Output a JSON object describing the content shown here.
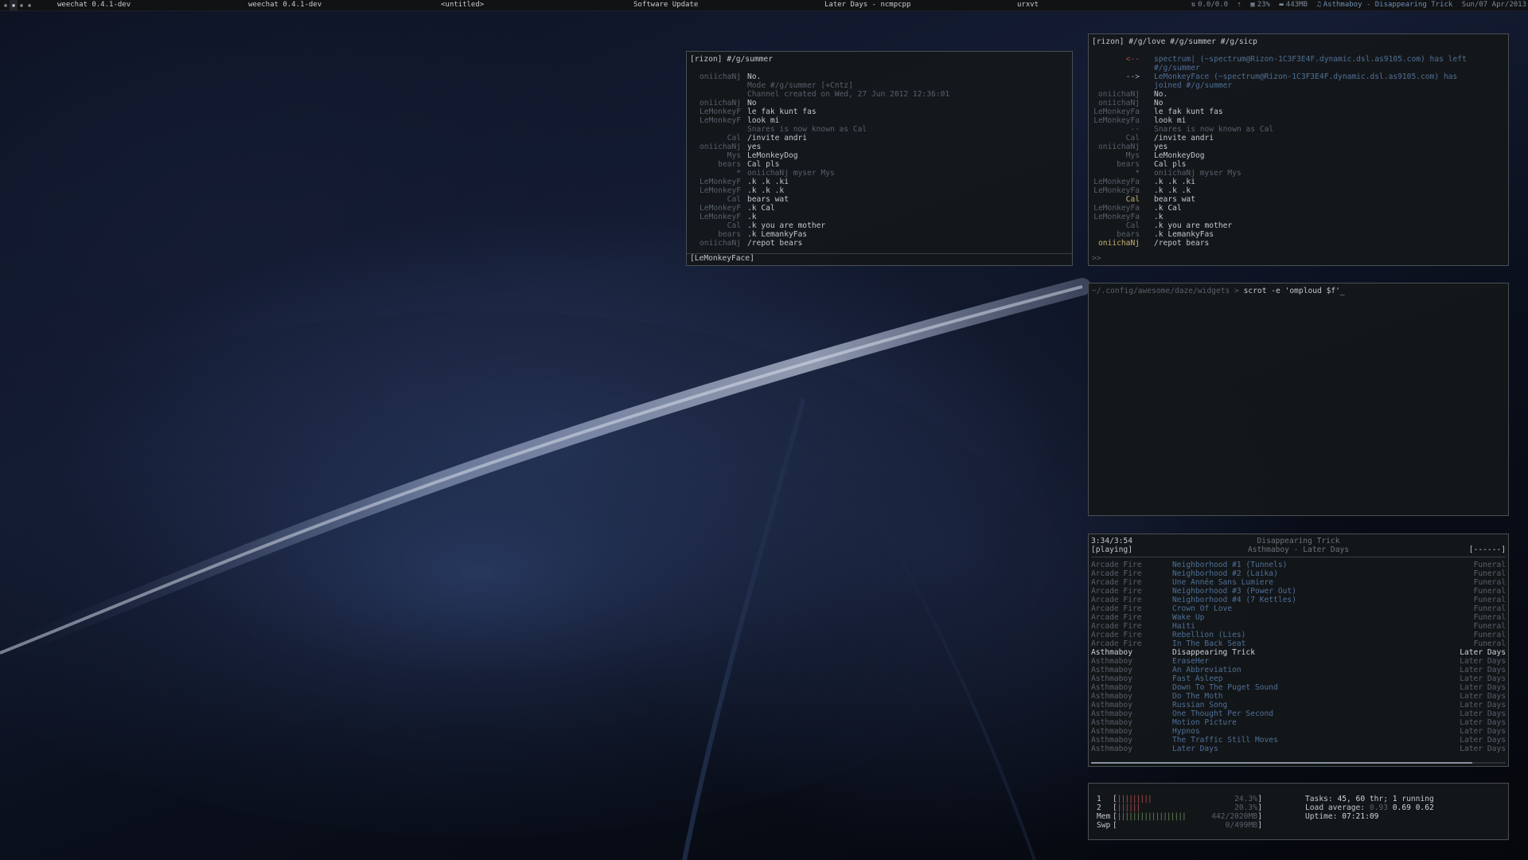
{
  "topbar": {
    "tasks": [
      {
        "label": "weechat 0.4.1-dev"
      },
      {
        "label": "weechat 0.4.1-dev"
      },
      {
        "label": "<untitled>"
      },
      {
        "label": "Software Update"
      },
      {
        "label": "Later Days - ncmpcpp"
      },
      {
        "label": "urxvt"
      }
    ],
    "widgets": {
      "net": "0.0/0.0",
      "cpu": "23%",
      "mem": "443MB",
      "nowplaying": "Asthmaboy - Disappearing Trick",
      "date": "Sun/07 Apr/2013"
    }
  },
  "chat1": {
    "title": "[rizon] #/g/summer",
    "lines": [
      {
        "nick": "oniichaNj",
        "text": "No.",
        "style": "norm"
      },
      {
        "nick": "",
        "text": "Mode #/g/summer [+Cntz]",
        "style": "dim"
      },
      {
        "nick": "",
        "text": "Channel created on Wed, 27 Jun 2012 12:36:01",
        "style": "dim"
      },
      {
        "nick": "oniichaNj",
        "text": "No",
        "style": "norm"
      },
      {
        "nick": "LeMonkeyF",
        "text": "le fak kunt fas",
        "style": "norm"
      },
      {
        "nick": "LeMonkeyF",
        "text": "look mi",
        "style": "norm"
      },
      {
        "nick": "",
        "text": "Snares is now known as Cal",
        "style": "dim"
      },
      {
        "nick": "Cal",
        "text": "/invite andri",
        "style": "norm"
      },
      {
        "nick": "oniichaNj",
        "text": "yes",
        "style": "norm"
      },
      {
        "nick": "Mys",
        "text": "LeMonkeyDog",
        "style": "norm"
      },
      {
        "nick": "bears",
        "text": "Cal pls",
        "style": "norm"
      },
      {
        "nick": "*",
        "text": "oniichaNj myser Mys",
        "style": "dim"
      },
      {
        "nick": "LeMonkeyF",
        "text": ".k .k .ki",
        "style": "norm"
      },
      {
        "nick": "LeMonkeyF",
        "text": ".k .k .k",
        "style": "norm"
      },
      {
        "nick": "Cal",
        "text": "bears wat",
        "style": "norm"
      },
      {
        "nick": "LeMonkeyF",
        "text": ".k Cal",
        "style": "norm"
      },
      {
        "nick": "LeMonkeyF",
        "text": ".k",
        "style": "norm"
      },
      {
        "nick": "Cal",
        "text": ".k you are mother",
        "style": "norm"
      },
      {
        "nick": "bears",
        "text": ".k LemankyFas",
        "style": "norm"
      },
      {
        "nick": "oniichaNj",
        "text": "/repot bears",
        "style": "norm"
      }
    ],
    "input": "[LeMonkeyFace]"
  },
  "chat2": {
    "title": "[rizon] #/g/love #/g/summer #/g/sicp",
    "lines": [
      {
        "nick": "<--",
        "text": "spectrum| (~spectrum@Rizon-1C3F3E4F.dynamic.dsl.as9105.com) has left",
        "style": "out"
      },
      {
        "nick": "",
        "text": "#/g/summer",
        "style": "cont"
      },
      {
        "nick": "-->",
        "text": "LeMonkeyFace (~spectrum@Rizon-1C3F3E4F.dynamic.dsl.as9105.com) has",
        "style": "in"
      },
      {
        "nick": "",
        "text": "joined #/g/summer",
        "style": "cont"
      },
      {
        "nick": "oniichaNj",
        "text": "No.",
        "style": "norm"
      },
      {
        "nick": "oniichaNj",
        "text": "No",
        "style": "norm"
      },
      {
        "nick": "LeMonkeyFa",
        "text": "le fak kunt fas",
        "style": "norm"
      },
      {
        "nick": "LeMonkeyFa",
        "text": "look mi",
        "style": "norm"
      },
      {
        "nick": "--",
        "text": "Snares is now known as Cal",
        "style": "dim"
      },
      {
        "nick": "Cal",
        "text": "/invite andri",
        "style": "norm"
      },
      {
        "nick": "oniichaNj",
        "text": "yes",
        "style": "norm"
      },
      {
        "nick": "Mys",
        "text": "LeMonkeyDog",
        "style": "norm"
      },
      {
        "nick": "bears",
        "text": "Cal pls",
        "style": "norm"
      },
      {
        "nick": "*",
        "text": "oniichaNj myser Mys",
        "style": "dim"
      },
      {
        "nick": "LeMonkeyFa",
        "text": ".k .k .ki",
        "style": "norm"
      },
      {
        "nick": "LeMonkeyFa",
        "text": ".k .k .k",
        "style": "norm"
      },
      {
        "nick": "Cal",
        "text": "bears wat",
        "style": "self"
      },
      {
        "nick": "LeMonkeyFa",
        "text": ".k Cal",
        "style": "norm"
      },
      {
        "nick": "LeMonkeyFa",
        "text": ".k",
        "style": "norm"
      },
      {
        "nick": "Cal",
        "text": ".k you are mother",
        "style": "norm"
      },
      {
        "nick": "bears",
        "text": ".k LemankyFas",
        "style": "norm"
      },
      {
        "nick": "oniichaNj",
        "text": "/repot bears",
        "style": "selfnick"
      }
    ],
    "prompt": ">>"
  },
  "shell": {
    "path": "~/.config/awesome/daze/widgets",
    "sep": " > ",
    "command": "scrot -e 'omploud $f'_"
  },
  "player": {
    "time": "3:34/3:54",
    "state": "[playing]",
    "song_title": "Disappearing Trick",
    "song_artist_album": "Asthmaboy - Later Days",
    "flags": "[------]",
    "progress": 0.92,
    "tracks": [
      {
        "artist": "Arcade Fire",
        "title": "Neighborhood #1 (Tunnels)",
        "album": "Funeral",
        "state": "other"
      },
      {
        "artist": "Arcade Fire",
        "title": "Neighborhood #2 (Laika)",
        "album": "Funeral",
        "state": "other"
      },
      {
        "artist": "Arcade Fire",
        "title": "Une Année Sans Lumiere",
        "album": "Funeral",
        "state": "other"
      },
      {
        "artist": "Arcade Fire",
        "title": "Neighborhood #3 (Power Out)",
        "album": "Funeral",
        "state": "other"
      },
      {
        "artist": "Arcade Fire",
        "title": "Neighborhood #4 (7 Kettles)",
        "album": "Funeral",
        "state": "other"
      },
      {
        "artist": "Arcade Fire",
        "title": "Crown Of Love",
        "album": "Funeral",
        "state": "other"
      },
      {
        "artist": "Arcade Fire",
        "title": "Wake Up",
        "album": "Funeral",
        "state": "other"
      },
      {
        "artist": "Arcade Fire",
        "title": "Haiti",
        "album": "Funeral",
        "state": "other"
      },
      {
        "artist": "Arcade Fire",
        "title": "Rebellion (Lies)",
        "album": "Funeral",
        "state": "other"
      },
      {
        "artist": "Arcade Fire",
        "title": "In The Back Seat",
        "album": "Funeral",
        "state": "other"
      },
      {
        "artist": "Asthmaboy",
        "title": "Disappearing Trick",
        "album": "Later Days",
        "state": "cur"
      },
      {
        "artist": "Asthmaboy",
        "title": "EraseHer",
        "album": "Later Days",
        "state": "other"
      },
      {
        "artist": "Asthmaboy",
        "title": "An Abbreviation",
        "album": "Later Days",
        "state": "other"
      },
      {
        "artist": "Asthmaboy",
        "title": "Fast Asleep",
        "album": "Later Days",
        "state": "other"
      },
      {
        "artist": "Asthmaboy",
        "title": "Down To The Puget Sound",
        "album": "Later Days",
        "state": "other"
      },
      {
        "artist": "Asthmaboy",
        "title": "Do The Moth",
        "album": "Later Days",
        "state": "other"
      },
      {
        "artist": "Asthmaboy",
        "title": "Russian Song",
        "album": "Later Days",
        "state": "other"
      },
      {
        "artist": "Asthmaboy",
        "title": "One Thought Per Second",
        "album": "Later Days",
        "state": "other"
      },
      {
        "artist": "Asthmaboy",
        "title": "Motion Picture",
        "album": "Later Days",
        "state": "other"
      },
      {
        "artist": "Asthmaboy",
        "title": "Hypnos",
        "album": "Later Days",
        "state": "other"
      },
      {
        "artist": "Asthmaboy",
        "title": "The Traffic Still Moves",
        "album": "Later Days",
        "state": "other"
      },
      {
        "artist": "Asthmaboy",
        "title": "Later Days",
        "album": "Later Days",
        "state": "other"
      }
    ]
  },
  "htop": {
    "bars": [
      {
        "label": "1",
        "ticks": "|||||||||",
        "value": "24.3%"
      },
      {
        "label": "2",
        "ticks": "||||||",
        "value": "20.3%"
      },
      {
        "label": "Mem",
        "ticks": "||||||||||||||||||",
        "value": "442/2020MB"
      },
      {
        "label": "Swp",
        "ticks": "",
        "value": "0/499MB"
      }
    ],
    "tasks_label": "Tasks:",
    "tasks_value": "45, 60",
    "thr_label": "thr;",
    "thr_value": "1",
    "running_label": "running",
    "load_label": "Load average:",
    "load1": "0.93",
    "load5": "0.69",
    "load15": "0.62",
    "uptime_label": "Uptime:",
    "uptime_value": "07:21:09"
  }
}
